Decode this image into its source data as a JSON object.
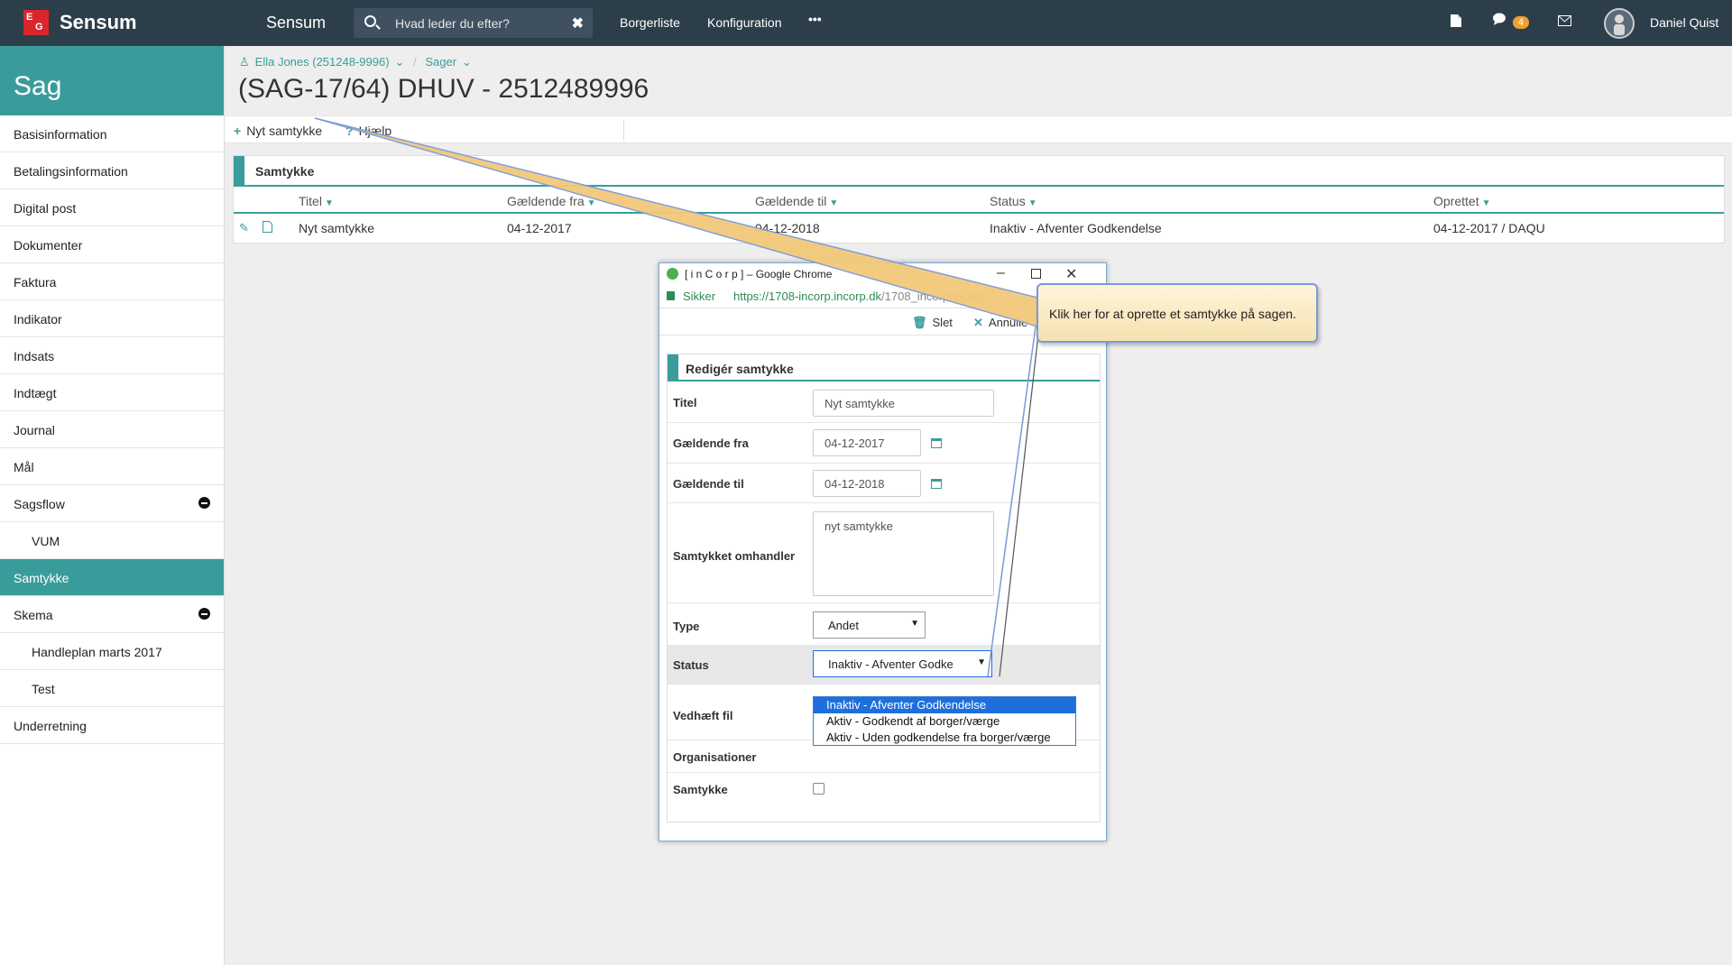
{
  "topbar": {
    "logo_letters": [
      "E",
      "G"
    ],
    "logo_text": "Sensum",
    "app_name": "Sensum",
    "search_placeholder": "Hvad leder du efter?",
    "nav": [
      "Borgerliste",
      "Konfiguration",
      "•••"
    ],
    "notifications_count": "4",
    "user_name": "Daniel Quist"
  },
  "sidebar": {
    "title": "Sag",
    "items": [
      {
        "label": "Basisinformation"
      },
      {
        "label": "Betalingsinformation"
      },
      {
        "label": "Digital post"
      },
      {
        "label": "Dokumenter"
      },
      {
        "label": "Faktura"
      },
      {
        "label": "Indikator"
      },
      {
        "label": "Indsats"
      },
      {
        "label": "Indtægt"
      },
      {
        "label": "Journal"
      },
      {
        "label": "Mål"
      },
      {
        "label": "Sagsflow"
      },
      {
        "label": "VUM"
      },
      {
        "label": "Samtykke"
      },
      {
        "label": "Skema"
      },
      {
        "label": "Handleplan marts 2017"
      },
      {
        "label": "Test"
      },
      {
        "label": "Underretning"
      }
    ]
  },
  "breadcrumb": {
    "person": "Ella Jones (251248-9996)",
    "section": "Sager"
  },
  "page_title": "(SAG-17/64) DHUV - 2512489996",
  "toolbar": {
    "new_label": "Nyt samtykke",
    "help_label": "Hjælp"
  },
  "table": {
    "title": "Samtykke",
    "headers": [
      "Titel",
      "Gældende fra",
      "Gældende til",
      "Status",
      "Oprettet"
    ],
    "rows": [
      [
        "Nyt samtykke",
        "04-12-2017",
        "04-12-2018",
        "Inaktiv - Afventer Godkendelse",
        "04-12-2017 / DAQU"
      ]
    ]
  },
  "popup": {
    "window_title": "[ i n C o r p ] – Google Chrome",
    "secure_label": "Sikker",
    "url": "https://1708-incorp.incorp.dk",
    "url_rest": "/1708_incorp/incorp",
    "delete_label": "Slet",
    "cancel_label": "Annulle",
    "form_title": "Redigér samtykke",
    "fields": {
      "title_label": "Titel",
      "title_value": "Nyt samtykke",
      "from_label": "Gældende fra",
      "from_value": "04-12-2017",
      "to_label": "Gældende til",
      "to_value": "04-12-2018",
      "about_label": "Samtykket omhandler",
      "about_value": "nyt samtykke",
      "type_label": "Type",
      "type_value": "Andet",
      "status_label": "Status",
      "status_value": "Inaktiv - Afventer Godke",
      "attach_label": "Vedhæft fil",
      "org_label": "Organisationer",
      "consent_label": "Samtykke"
    },
    "status_options": [
      "Inaktiv - Afventer Godkendelse",
      "Aktiv - Godkendt af borger/værge",
      "Aktiv - Uden godkendelse fra borger/værge"
    ]
  },
  "callout": {
    "text": "Klik her for at oprette et samtykke på sagen."
  },
  "colors": {
    "accent": "#3a9c9a",
    "topbar": "#2c3e4a",
    "selection": "#1e6fdc",
    "badge": "#f0a030"
  }
}
